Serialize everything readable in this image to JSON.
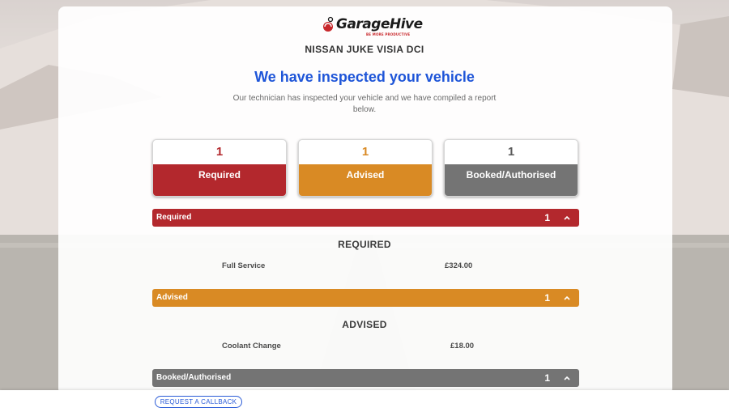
{
  "brand": {
    "name": "GarageHive",
    "tagline": "BE MORE PRODUCTIVE"
  },
  "vehicle": "NISSAN JUKE VISIA DCI",
  "headline": "We have inspected your vehicle",
  "subtext": "Our technician has inspected your vehicle and we have compiled a report below.",
  "summary": [
    {
      "count": "1",
      "label": "Required",
      "color": "#b3282d",
      "num_color": "#b3282d"
    },
    {
      "count": "1",
      "label": "Advised",
      "color": "#d98a24",
      "num_color": "#d98a24"
    },
    {
      "count": "1",
      "label": "Booked/Authorised",
      "color": "#747474",
      "num_color": "#5a5a5a"
    }
  ],
  "sections": [
    {
      "label": "Required",
      "count": "1",
      "color": "#b3282d",
      "title": "REQUIRED",
      "items": [
        {
          "name": "Full Service",
          "price": "£324.00"
        }
      ]
    },
    {
      "label": "Advised",
      "count": "1",
      "color": "#d98a24",
      "title": "ADVISED",
      "items": [
        {
          "name": "Coolant Change",
          "price": "£18.00"
        }
      ]
    },
    {
      "label": "Booked/Authorised",
      "count": "1",
      "color": "#747474"
    }
  ],
  "footer": {
    "callback_label": "REQUEST A CALLBACK"
  }
}
